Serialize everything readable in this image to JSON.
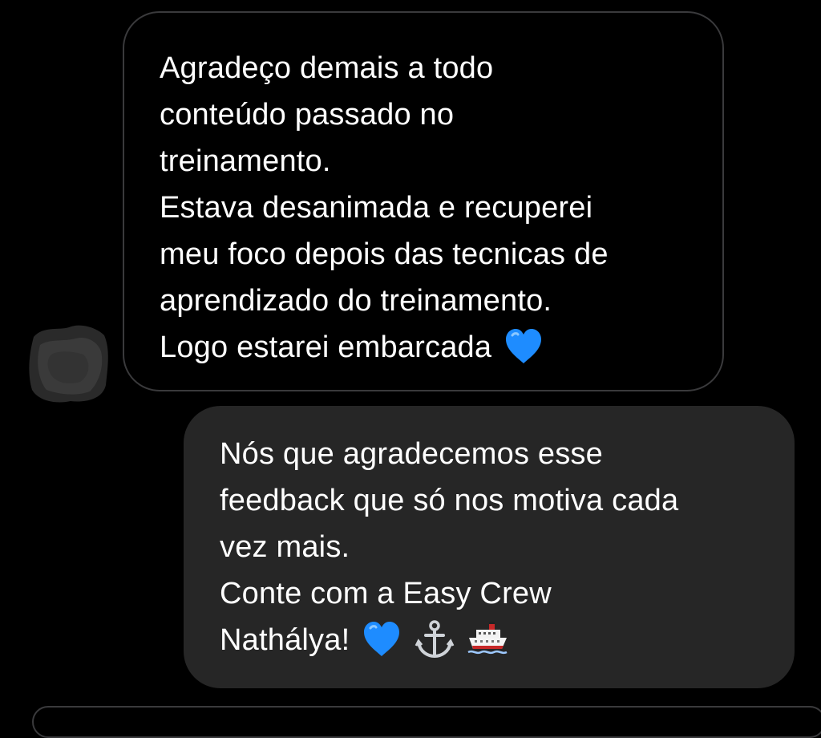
{
  "conversation": {
    "received": {
      "lines": [
        "Agradeço demais a todo",
        "conteúdo passado no",
        "treinamento.",
        "Estava desanimada e recuperei",
        "meu foco depois das tecnicas de",
        "aprendizado do treinamento.",
        "Logo estarei embarcada"
      ],
      "emojis": [
        "blue-heart-icon"
      ]
    },
    "sent": {
      "lines": [
        "Nós que agradecemos esse",
        "feedback que só nos motiva cada",
        "vez mais.",
        "Conte com a Easy Crew",
        "Nathálya!"
      ],
      "emojis": [
        "blue-heart-icon",
        "anchor-icon",
        "ship-icon"
      ]
    }
  },
  "colors": {
    "background": "#000000",
    "received_border": "#3a3a3c",
    "sent_bubble": "#262626",
    "text": "#ffffff",
    "heart": "#1e8cff"
  }
}
